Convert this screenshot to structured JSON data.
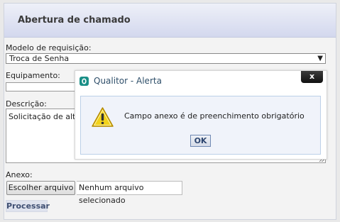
{
  "panel": {
    "title": "Abertura de chamado"
  },
  "form": {
    "modelo_label": "Modelo de requisição:",
    "modelo_value": "Troca de Senha",
    "equipamento_label": "Equipamento:",
    "descricao_label": "Descrição:",
    "descricao_value": "Solicitação de alte",
    "anexo_label": "Anexo:",
    "file_button_label": "Escolher arquivo",
    "file_status": "Nenhum arquivo selecionado",
    "submit_label": "Processar"
  },
  "dialog": {
    "title": "Qualitor - Alerta",
    "close_label": "x",
    "message": "Campo anexo é de preenchimento obrigatório",
    "ok_label": "OK"
  },
  "icons": {
    "dropdown": "triangle-down-icon",
    "app_logo": "qualitor-logo-icon",
    "warning": "warning-triangle-icon"
  },
  "colors": {
    "header_bg": "#d3d8ee",
    "dialog_title": "#2f4f6a",
    "dialog_body_bg": "#f0f3fa",
    "ok_border": "#6f88b3",
    "logo": "#1a8f87",
    "warning_fill": "#f2d21a"
  }
}
